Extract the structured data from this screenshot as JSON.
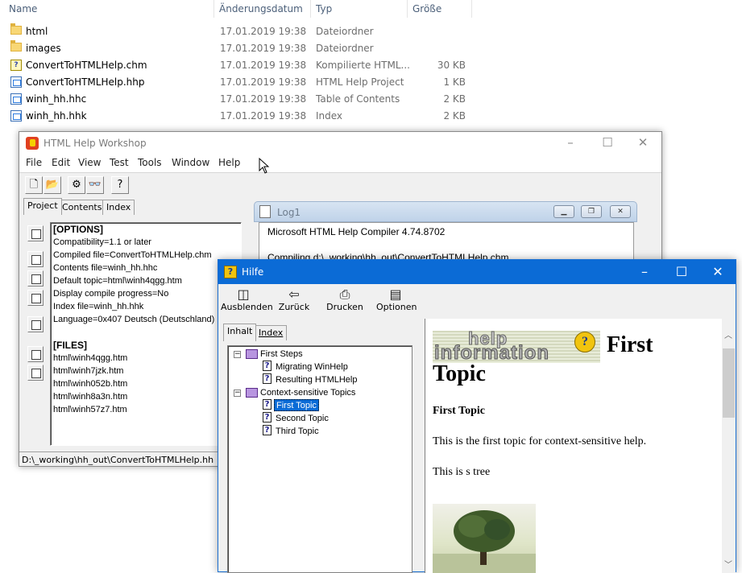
{
  "explorer": {
    "columns": {
      "name": "Name",
      "date": "Änderungsdatum",
      "type": "Typ",
      "size": "Größe"
    },
    "files": [
      {
        "name": "html",
        "date": "17.01.2019 19:38",
        "type": "Dateiordner",
        "size": "",
        "icon": "folder-icon"
      },
      {
        "name": "images",
        "date": "17.01.2019 19:38",
        "type": "Dateiordner",
        "size": "",
        "icon": "folder-icon"
      },
      {
        "name": "ConvertToHTMLHelp.chm",
        "date": "17.01.2019 19:38",
        "type": "Kompilierte HTML...",
        "size": "30 KB",
        "icon": "chm-file-icon"
      },
      {
        "name": "ConvertToHTMLHelp.hhp",
        "date": "17.01.2019 19:38",
        "type": "HTML Help Project",
        "size": "1 KB",
        "icon": "hhp-file-icon"
      },
      {
        "name": "winh_hh.hhc",
        "date": "17.01.2019 19:38",
        "type": "Table of Contents",
        "size": "2 KB",
        "icon": "hhc-file-icon"
      },
      {
        "name": "winh_hh.hhk",
        "date": "17.01.2019 19:38",
        "type": "Index",
        "size": "2 KB",
        "icon": "hhk-file-icon"
      }
    ]
  },
  "workshop": {
    "title": "HTML Help Workshop",
    "menu": [
      "File",
      "Edit",
      "View",
      "Test",
      "Tools",
      "Window",
      "Help"
    ],
    "tabs": [
      "Project",
      "Contents",
      "Index"
    ],
    "project_lines": [
      "[OPTIONS]",
      "Compatibility=1.1 or later",
      "Compiled file=ConvertToHTMLHelp.chm",
      "Contents file=winh_hh.hhc",
      "Default topic=html\\winh4qgg.htm",
      "Display compile progress=No",
      "Index file=winh_hh.hhk",
      "Language=0x407 Deutsch (Deutschland)",
      "",
      "[FILES]",
      "html\\winh4qgg.htm",
      "html\\winh7jzk.htm",
      "html\\winh052b.htm",
      "html\\winh8a3n.htm",
      "html\\winh57z7.htm"
    ],
    "status": "D:\\_working\\hh_out\\ConvertToHTMLHelp.hh",
    "log": {
      "title": "Log1",
      "lines": [
        "Microsoft HTML Help Compiler 4.74.8702",
        "",
        "Compiling d:\\_working\\hh_out\\ConvertToHTMLHelp.chm"
      ]
    }
  },
  "hilfe": {
    "title": "Hilfe",
    "toolbar": [
      {
        "label": "Ausblenden",
        "icon": "hide-icon"
      },
      {
        "label": "Zurück",
        "icon": "back-arrow-icon"
      },
      {
        "label": "Drucken",
        "icon": "printer-icon"
      },
      {
        "label": "Optionen",
        "icon": "options-icon"
      }
    ],
    "tabs": [
      "Inhalt",
      "Index"
    ],
    "tree": [
      {
        "label": "First Steps",
        "kind": "book",
        "level": 0,
        "expanded": true
      },
      {
        "label": "Migrating WinHelp",
        "kind": "page",
        "level": 1
      },
      {
        "label": "Resulting HTMLHelp",
        "kind": "page",
        "level": 1
      },
      {
        "label": "Context-sensitive Topics",
        "kind": "book",
        "level": 0,
        "expanded": true
      },
      {
        "label": "First Topic",
        "kind": "page",
        "level": 1,
        "selected": true
      },
      {
        "label": "Second Topic",
        "kind": "page",
        "level": 1
      },
      {
        "label": "Third Topic",
        "kind": "page",
        "level": 1
      }
    ],
    "content": {
      "logo_word1": "help",
      "logo_word2": "information",
      "heading_part1": "First",
      "heading_part2": "Topic",
      "subheading": "First Topic",
      "para1": "This is the first topic for context-sensitive help.",
      "para2": "This is s tree"
    }
  },
  "colors": {
    "titlebar_active": "#0b6bd6",
    "selection": "#0b6bd6"
  }
}
